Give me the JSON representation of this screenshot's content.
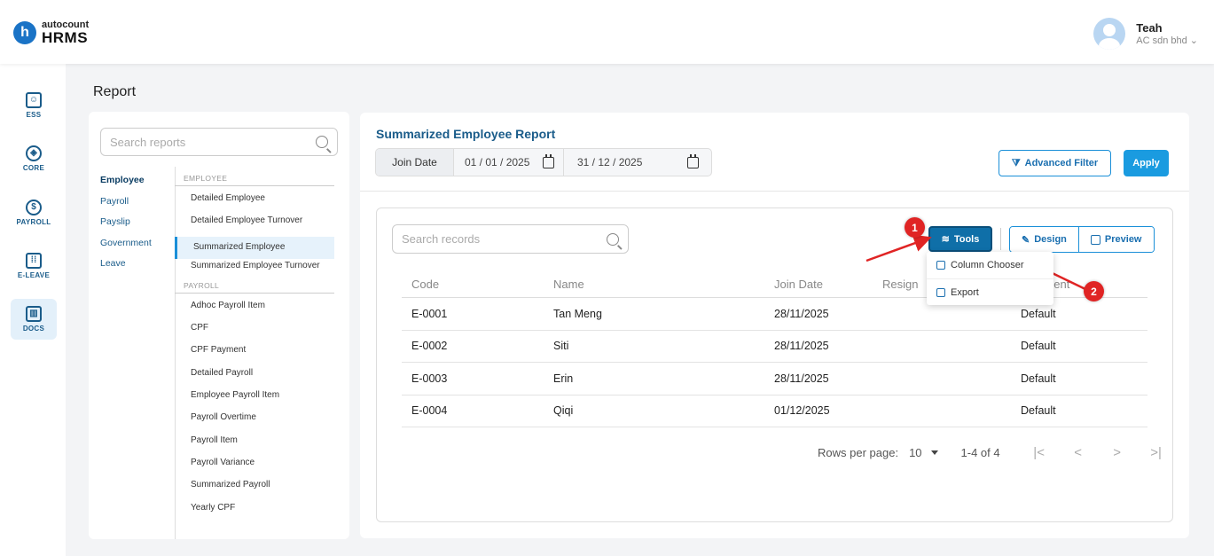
{
  "brand": {
    "logo_letter": "h",
    "name_top": "autocount",
    "name_bottom": "HRMS"
  },
  "user": {
    "name": "Teah",
    "company": "AC sdn bhd"
  },
  "sidenav": [
    {
      "label": "ESS",
      "icon": "ess-icon"
    },
    {
      "label": "CORE",
      "icon": "core-icon"
    },
    {
      "label": "PAYROLL",
      "icon": "payroll-icon"
    },
    {
      "label": "E-LEAVE",
      "icon": "calendar-icon"
    },
    {
      "label": "DOCS",
      "icon": "docs-icon",
      "active": true
    }
  ],
  "page": {
    "title": "Report"
  },
  "reports_panel": {
    "search_placeholder": "Search reports",
    "categories": [
      "Employee",
      "Payroll",
      "Payslip",
      "Government",
      "Leave"
    ],
    "sections": [
      {
        "header": "EMPLOYEE",
        "items": [
          "Detailed Employee",
          "Detailed Employee Turnover",
          "Summarized Employee",
          "Summarized Employee Turnover"
        ]
      },
      {
        "header": "PAYROLL",
        "items": [
          "Adhoc Payroll Item",
          "CPF",
          "CPF Payment",
          "Detailed Payroll",
          "Employee Payroll Item",
          "Payroll Overtime",
          "Payroll Item",
          "Payroll Variance",
          "Summarized Payroll",
          "Yearly CPF"
        ]
      }
    ]
  },
  "report": {
    "title": "Summarized Employee Report",
    "date_label": "Join Date",
    "date_from": "01 / 01 / 2025",
    "date_to": "31 / 12 / 2025",
    "advanced_filter": "Advanced Filter",
    "apply": "Apply",
    "search_placeholder": "Search records",
    "tools": "Tools",
    "design": "Design",
    "preview": "Preview",
    "columns": [
      "Code",
      "Name",
      "Join Date",
      "Resign",
      "nent"
    ],
    "rows": [
      [
        "E-0001",
        "Tan Meng",
        "28/11/2025",
        "",
        "Default"
      ],
      [
        "E-0002",
        "Siti",
        "28/11/2025",
        "",
        "Default"
      ],
      [
        "E-0003",
        "Erin",
        "28/11/2025",
        "",
        "Default"
      ],
      [
        "E-0004",
        "Qiqi",
        "01/12/2025",
        "",
        "Default"
      ]
    ],
    "rows_per_page_label": "Rows per page:",
    "rows_per_page": "10",
    "range": "1-4 of 4"
  },
  "tools_menu": {
    "items": [
      "Column Chooser",
      "Export"
    ]
  },
  "annotations": {
    "badge1": "1",
    "badge2": "2",
    "color": "#e02424"
  }
}
